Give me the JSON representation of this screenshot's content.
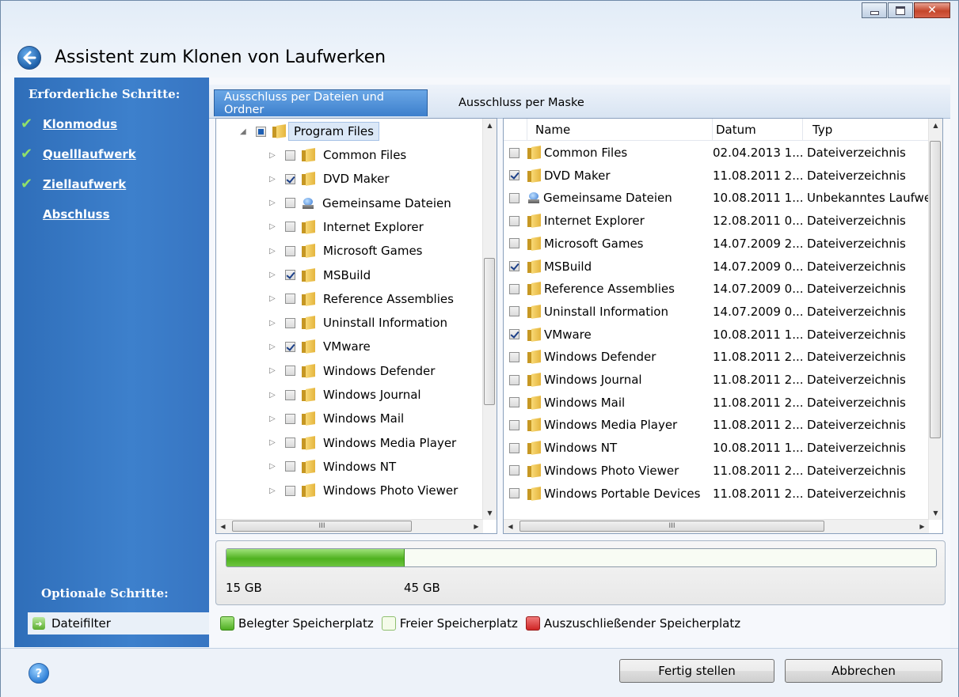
{
  "window": {
    "title": "Assistent zum Klonen von Laufwerken"
  },
  "left_pane": {
    "required_heading": "Erforderliche Schritte:",
    "steps": [
      {
        "label": "Klonmodus",
        "done": true
      },
      {
        "label": "Quelllaufwerk",
        "done": true
      },
      {
        "label": "Ziellaufwerk",
        "done": true
      },
      {
        "label": "Abschluss",
        "done": false
      }
    ],
    "optional_heading": "Optionale Schritte:",
    "optional_item": "Dateifilter"
  },
  "tabs": [
    {
      "label": "Ausschluss per Dateien und Ordner",
      "active": true
    },
    {
      "label": "Ausschluss per Maske",
      "active": false
    }
  ],
  "tree": {
    "root": {
      "label": "Program Files",
      "state": "partial"
    },
    "items": [
      {
        "label": "Common Files",
        "checked": false,
        "icon": "folder-icon"
      },
      {
        "label": "DVD Maker",
        "checked": true,
        "icon": "folder-icon"
      },
      {
        "label": "Gemeinsame Dateien",
        "checked": false,
        "icon": "drive-icon"
      },
      {
        "label": "Internet Explorer",
        "checked": false,
        "icon": "folder-icon"
      },
      {
        "label": "Microsoft Games",
        "checked": false,
        "icon": "folder-icon"
      },
      {
        "label": "MSBuild",
        "checked": true,
        "icon": "folder-icon"
      },
      {
        "label": "Reference Assemblies",
        "checked": false,
        "icon": "folder-icon"
      },
      {
        "label": "Uninstall Information",
        "checked": false,
        "icon": "folder-icon"
      },
      {
        "label": "VMware",
        "checked": true,
        "icon": "folder-icon"
      },
      {
        "label": "Windows Defender",
        "checked": false,
        "icon": "folder-icon"
      },
      {
        "label": "Windows Journal",
        "checked": false,
        "icon": "folder-icon"
      },
      {
        "label": "Windows Mail",
        "checked": false,
        "icon": "folder-icon"
      },
      {
        "label": "Windows Media Player",
        "checked": false,
        "icon": "folder-icon"
      },
      {
        "label": "Windows NT",
        "checked": false,
        "icon": "folder-icon"
      },
      {
        "label": "Windows Photo Viewer",
        "checked": false,
        "icon": "folder-icon"
      }
    ]
  },
  "list": {
    "columns": [
      "Name",
      "Datum",
      "Typ"
    ],
    "rows": [
      {
        "name": "Common Files",
        "date": "02.04.2013 1...",
        "type": "Dateiverzeichnis",
        "checked": false,
        "icon": "folder-icon"
      },
      {
        "name": "DVD Maker",
        "date": "11.08.2011 2...",
        "type": "Dateiverzeichnis",
        "checked": true,
        "icon": "folder-icon"
      },
      {
        "name": "Gemeinsame Dateien",
        "date": "10.08.2011 1...",
        "type": "Unbekanntes Laufwe",
        "checked": false,
        "icon": "drive-icon"
      },
      {
        "name": "Internet Explorer",
        "date": "12.08.2011 0...",
        "type": "Dateiverzeichnis",
        "checked": false,
        "icon": "folder-icon"
      },
      {
        "name": "Microsoft Games",
        "date": "14.07.2009 2...",
        "type": "Dateiverzeichnis",
        "checked": false,
        "icon": "folder-icon"
      },
      {
        "name": "MSBuild",
        "date": "14.07.2009 0...",
        "type": "Dateiverzeichnis",
        "checked": true,
        "icon": "folder-icon"
      },
      {
        "name": "Reference Assemblies",
        "date": "14.07.2009 0...",
        "type": "Dateiverzeichnis",
        "checked": false,
        "icon": "folder-icon"
      },
      {
        "name": "Uninstall Information",
        "date": "14.07.2009 0...",
        "type": "Dateiverzeichnis",
        "checked": false,
        "icon": "folder-icon"
      },
      {
        "name": "VMware",
        "date": "10.08.2011 1...",
        "type": "Dateiverzeichnis",
        "checked": true,
        "icon": "folder-icon"
      },
      {
        "name": "Windows Defender",
        "date": "11.08.2011 2...",
        "type": "Dateiverzeichnis",
        "checked": false,
        "icon": "folder-icon"
      },
      {
        "name": "Windows Journal",
        "date": "11.08.2011 2...",
        "type": "Dateiverzeichnis",
        "checked": false,
        "icon": "folder-icon"
      },
      {
        "name": "Windows Mail",
        "date": "11.08.2011 2...",
        "type": "Dateiverzeichnis",
        "checked": false,
        "icon": "folder-icon"
      },
      {
        "name": "Windows Media Player",
        "date": "11.08.2011 2...",
        "type": "Dateiverzeichnis",
        "checked": false,
        "icon": "folder-icon"
      },
      {
        "name": "Windows NT",
        "date": "10.08.2011 1...",
        "type": "Dateiverzeichnis",
        "checked": false,
        "icon": "folder-icon"
      },
      {
        "name": "Windows Photo Viewer",
        "date": "11.08.2011 2...",
        "type": "Dateiverzeichnis",
        "checked": false,
        "icon": "folder-icon"
      },
      {
        "name": "Windows Portable Devices",
        "date": "11.08.2011 2...",
        "type": "Dateiverzeichnis",
        "checked": false,
        "icon": "folder-icon"
      }
    ]
  },
  "usage": {
    "used_fraction": 0.25,
    "used_label": "15 GB",
    "total_label": "45 GB"
  },
  "legend": [
    {
      "label": "Belegter Speicherplatz",
      "color": "#5cbf2a"
    },
    {
      "label": "Freier Speicherplatz",
      "color": "#f4fbe9"
    },
    {
      "label": "Auszuschließender Speicherplatz",
      "color": "#d93a3a"
    }
  ],
  "buttons": {
    "finish": {
      "label": "Fertig stellen"
    },
    "cancel": {
      "label": "Abbrechen"
    }
  },
  "colors": {
    "accent": "#3a7ac6",
    "check": "#8fe06a"
  }
}
